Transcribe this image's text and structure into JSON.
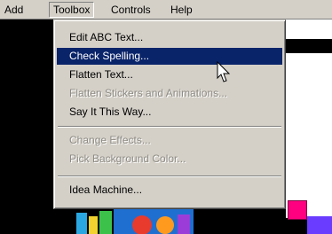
{
  "menubar": {
    "items": [
      {
        "label": "Add"
      },
      {
        "label": "Toolbox"
      },
      {
        "label": "Controls"
      },
      {
        "label": "Help"
      }
    ]
  },
  "toolbox_menu": {
    "items": [
      {
        "label": "Edit ABC Text...",
        "state": "enabled"
      },
      {
        "label": "Check Spelling...",
        "state": "highlighted"
      },
      {
        "label": "Flatten Text...",
        "state": "enabled"
      },
      {
        "label": "Flatten Stickers and Animations...",
        "state": "disabled"
      },
      {
        "label": "Say It This Way...",
        "state": "enabled"
      },
      {
        "label": "Change Effects...",
        "state": "disabled"
      },
      {
        "label": "Pick Background Color...",
        "state": "disabled"
      },
      {
        "label": "Idea Machine...",
        "state": "enabled"
      }
    ]
  },
  "colors": {
    "menu_bg": "#d4d0c8",
    "highlight": "#0a246a",
    "disabled_text": "#8e8b84",
    "sticker_pink": "#ff0080",
    "sticker_purple": "#6a3cff"
  }
}
